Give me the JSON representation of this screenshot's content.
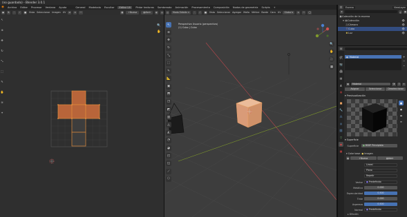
{
  "window": {
    "title": "(no guardado) - Blender 3.0.1"
  },
  "menu": [
    "Archivo",
    "Editar",
    "Procesar",
    "Ventana",
    "Ayuda"
  ],
  "workspaces": [
    "General",
    "Modelado",
    "Escultor",
    "Editar UV",
    "Pintar texturas",
    "Sombreado",
    "Animación",
    "Procesamiento",
    "Composición",
    "Nodos de geometría",
    "Scripts"
  ],
  "active_workspace_index": 3,
  "uv_editor": {
    "header": {
      "view": "Vista",
      "select": "Seleccionar",
      "image": "Imagen",
      "uvs": "UV",
      "new": "Nueva",
      "open": "Abrir"
    }
  },
  "viewport": {
    "header": {
      "mode": "Modo Edición",
      "view": "Vista",
      "select": "Seleccionar",
      "add": "Agregar",
      "mesh": "Malla",
      "vertex": "Vértice",
      "edge": "Borde",
      "face": "Cara",
      "uv": "UV",
      "orientation": "Global",
      "options": "Opciones"
    },
    "info_line1": "Perspectiva Usuario (perspectiva)",
    "info_line2": "(1) Cubo | Cubo"
  },
  "outliner": {
    "search_label": "Escena",
    "layer_label": "ViewLayer",
    "scene_collection": "Colección de la escena",
    "items": [
      {
        "name": "Colección",
        "depth": 1
      },
      {
        "name": "Cámara",
        "depth": 2
      },
      {
        "name": "Cubo",
        "depth": 2,
        "selected": true
      },
      {
        "name": "Luz",
        "depth": 2
      }
    ]
  },
  "properties": {
    "search_placeholder": "",
    "material_slot": "Material",
    "material_name": "Material",
    "actions": [
      "Asignar",
      "Seleccionar",
      "Deseleccionar"
    ],
    "preview_label": "Previsualización",
    "surface_label": "Superficie",
    "surface_value": "BSDF Principista",
    "base_color_label": "Color base",
    "base_color_value": "Imagen",
    "image_new": "Nueva",
    "image_open": "Abrir",
    "interp": "Lineal",
    "proj": "Plano",
    "ext": "Repetir",
    "vector_label": "Vector",
    "vector_value": "Predefinido",
    "metallic_label": "Metálico",
    "metallic_value": "0.000",
    "specular_label": "Especularidad",
    "specular_value": "0.500",
    "specular_tint_label": "Tinte",
    "specular_tint_value": "0.000",
    "roughness_label": "Aspereza",
    "roughness_value": "0.500",
    "normal_label": "Normal",
    "normal_value": "Predefinido",
    "footer_section": "Difusión"
  },
  "colors": {
    "accent": "#4772b3",
    "uv_face": "#c0683a",
    "cube_face": "#d9a07c",
    "x_axis": "#b5474c",
    "y_axis": "#7f9a2b"
  }
}
